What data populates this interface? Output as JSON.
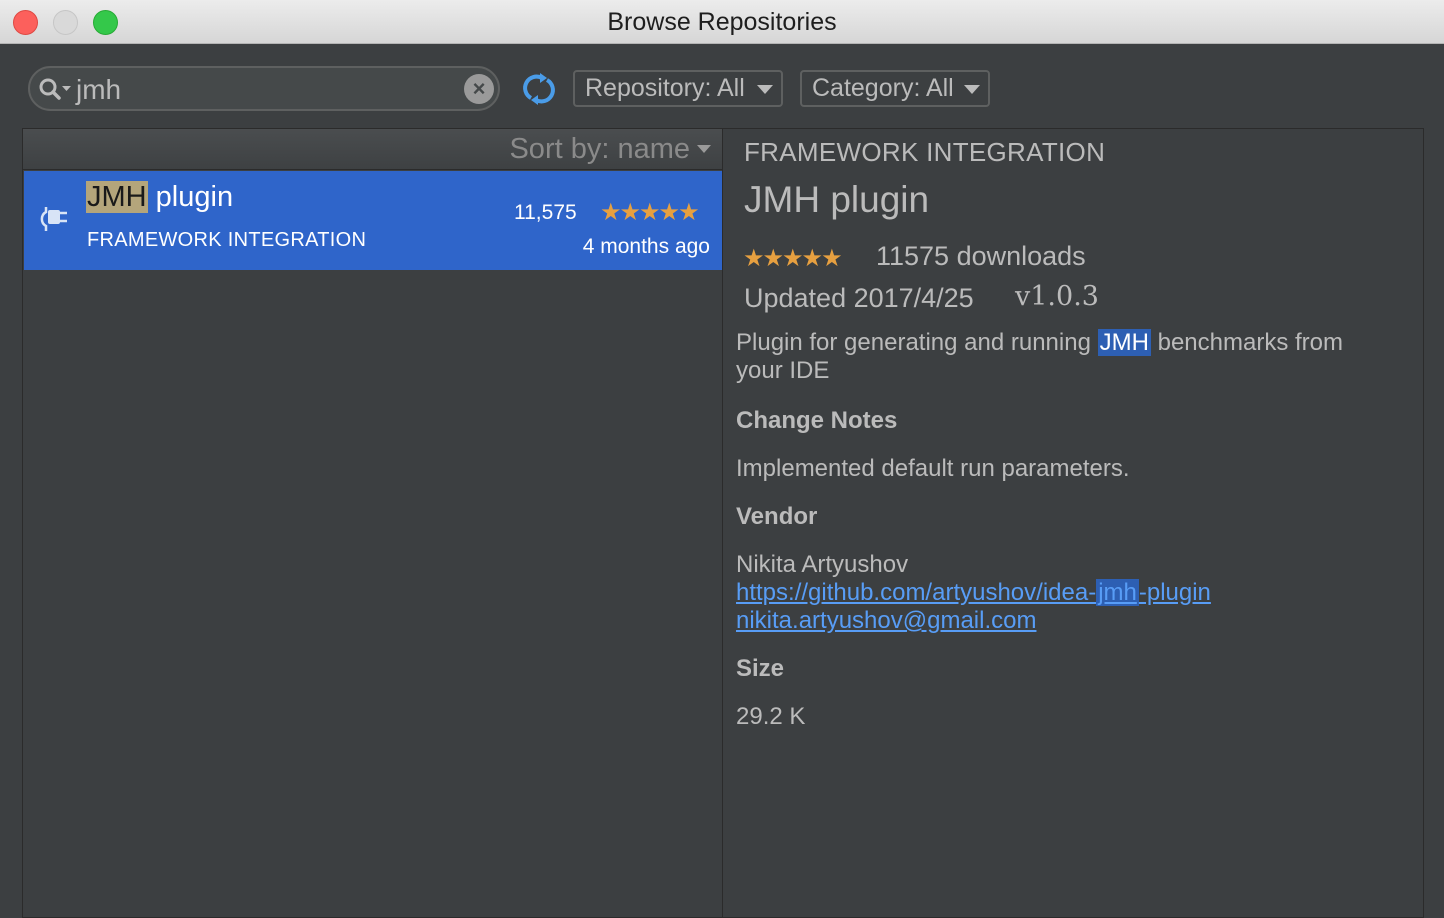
{
  "window": {
    "title": "Browse Repositories"
  },
  "toolbar": {
    "search_value": "jmh",
    "repository_label": "Repository: All",
    "category_label": "Category: All"
  },
  "list": {
    "sort_label": "Sort by: name",
    "items": [
      {
        "name_highlight": "JMH",
        "name_rest": " plugin",
        "category": "FRAMEWORK INTEGRATION",
        "downloads": "11,575",
        "rating": 5,
        "updated": "4 months ago"
      }
    ]
  },
  "detail": {
    "category": "FRAMEWORK INTEGRATION",
    "name": "JMH plugin",
    "rating": 5,
    "downloads": "11575 downloads",
    "updated": "Updated 2017/4/25",
    "version": "v1.0.3",
    "description_pre": "Plugin for generating and running ",
    "description_highlight": "JMH",
    "description_post": " benchmarks from your IDE",
    "change_notes_heading": "Change Notes",
    "change_notes": "Implemented default run parameters.",
    "vendor_heading": "Vendor",
    "vendor_name": "Nikita Artyushov",
    "vendor_url_pre": "https://github.com/artyushov/idea-",
    "vendor_url_highlight": "jmh",
    "vendor_url_post": "-plugin",
    "vendor_email": "nikita.artyushov@gmail.com",
    "size_heading": "Size",
    "size": "29.2 K"
  },
  "colors": {
    "selection": "#2f65ca",
    "star": "#e7a040",
    "link": "#589df6",
    "background": "#3c3f41"
  }
}
